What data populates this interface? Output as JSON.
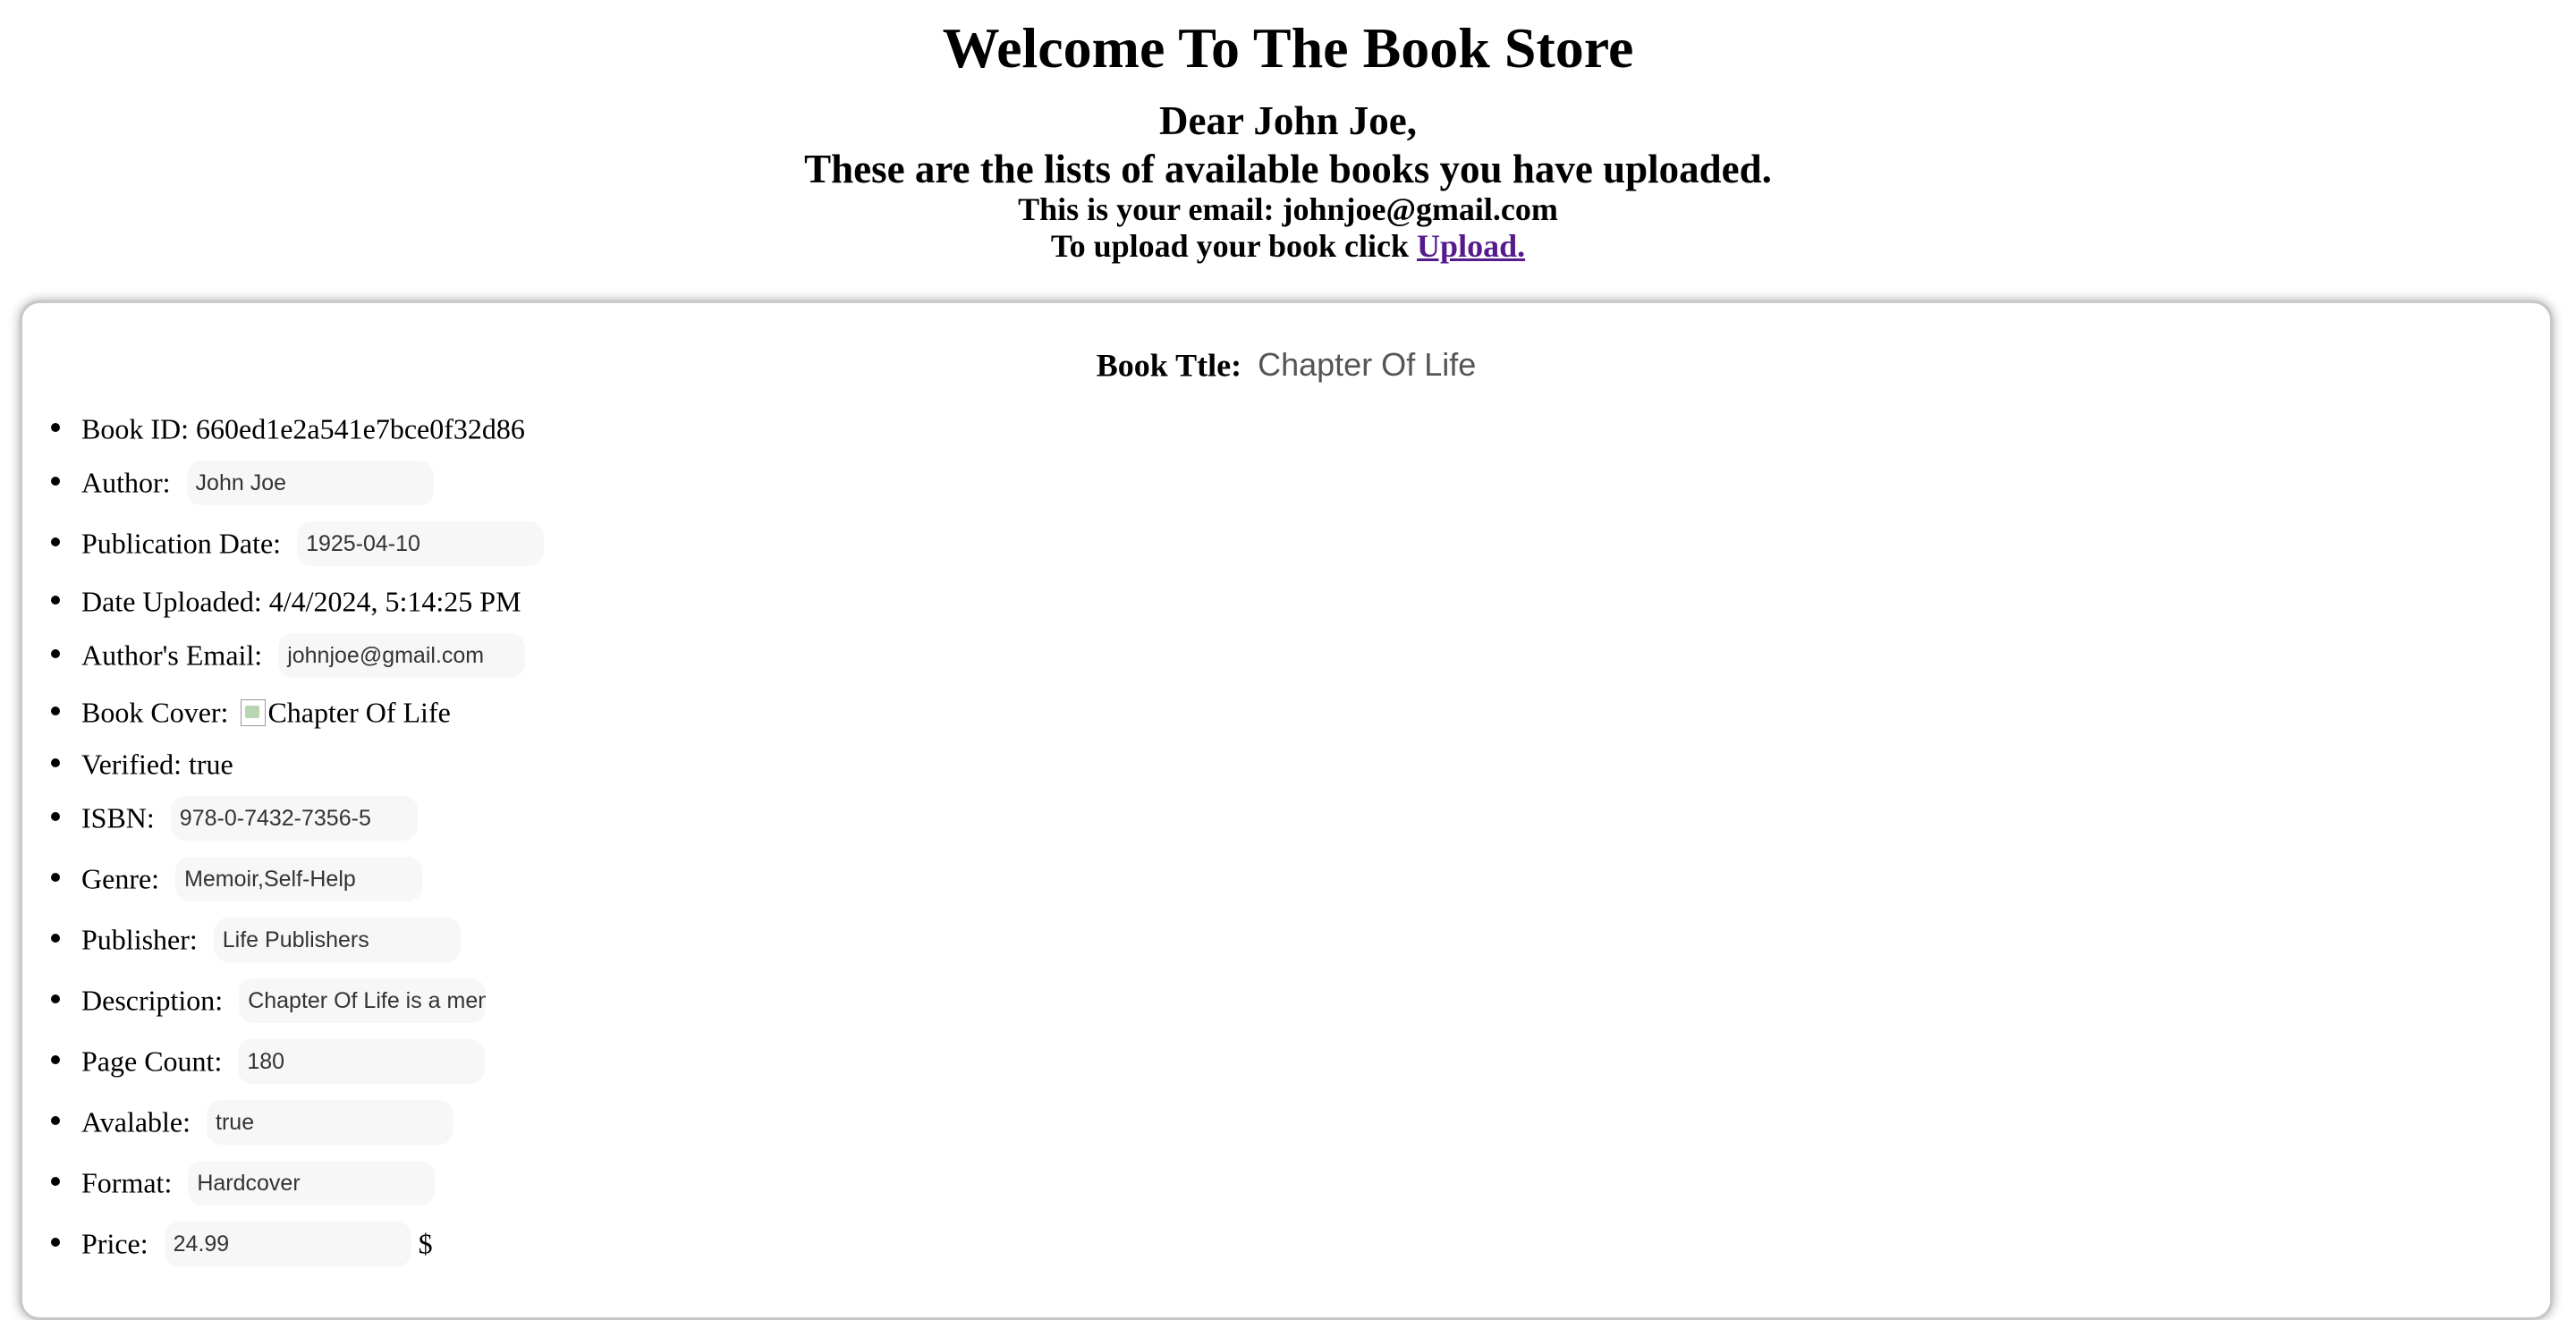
{
  "header": {
    "title": "Welcome To The Book Store",
    "greeting": "Dear John Joe,",
    "subtitle": "These are the lists of available books you have uploaded.",
    "email_line": "This is your email: johnjoe@gmail.com",
    "upload_prompt": "To upload your book click",
    "upload_link": "Upload."
  },
  "book": {
    "title_label": "Book Ttle:",
    "title_value": "Chapter Of Life",
    "id_text": "Book ID: 660ed1e2a541e7bce0f32d86",
    "author_label": "Author:",
    "author_value": "John Joe",
    "pubdate_label": "Publication Date:",
    "pubdate_value": "1925-04-10",
    "uploaded_text": "Date Uploaded: 4/4/2024, 5:14:25 PM",
    "email_label": "Author's Email:",
    "email_value": "johnjoe@gmail.com",
    "cover_label": "Book Cover:",
    "cover_alt": "Chapter Of Life",
    "verified_text": "Verified: true",
    "isbn_label": "ISBN:",
    "isbn_value": "978-0-7432-7356-5",
    "genre_label": "Genre:",
    "genre_value": "Memoir,Self-Help",
    "publisher_label": "Publisher:",
    "publisher_value": "Life Publishers",
    "description_label": "Description:",
    "description_value": "Chapter Of Life is a mem",
    "pagecount_label": "Page Count:",
    "pagecount_value": "180",
    "available_label": "Avalable:",
    "available_value": "true",
    "format_label": "Format:",
    "format_value": "Hardcover",
    "price_label": "Price:",
    "price_value": "24.99",
    "currency": "$"
  }
}
